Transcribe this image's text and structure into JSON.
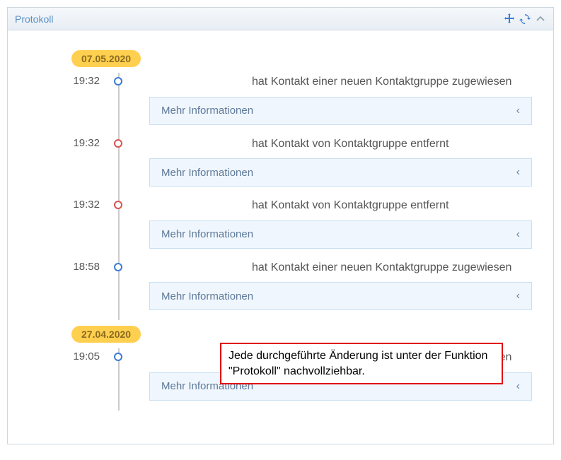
{
  "panel": {
    "title": "Protokoll",
    "controls": {
      "move": "move-icon",
      "refresh": "refresh-icon",
      "collapse": "chevron-up-icon"
    }
  },
  "timeline": [
    {
      "date": "07.05.2020",
      "entries": [
        {
          "time": "19:32",
          "dot": "blue",
          "text": "hat Kontakt einer neuen Kontaktgruppe zugewiesen",
          "more": "Mehr Informationen"
        },
        {
          "time": "19:32",
          "dot": "red",
          "text": "hat Kontakt von Kontaktgruppe entfernt",
          "more": "Mehr Informationen"
        },
        {
          "time": "19:32",
          "dot": "red",
          "text": "hat Kontakt von Kontaktgruppe entfernt",
          "more": "Mehr Informationen"
        },
        {
          "time": "18:58",
          "dot": "blue",
          "text": "hat Kontakt einer neuen Kontaktgruppe zugewiesen",
          "more": "Mehr Informationen"
        }
      ]
    },
    {
      "date": "27.04.2020",
      "entries": [
        {
          "time": "19:05",
          "dot": "blue",
          "text": "hat Kontakt einer neuen Kontaktgruppe zugewiesen",
          "more": "Mehr Informationen"
        }
      ]
    }
  ],
  "annotation": {
    "text": "Jede durchgeführte Änderung ist unter der Funktion \"Protokoll\" nachvollziehbar."
  }
}
